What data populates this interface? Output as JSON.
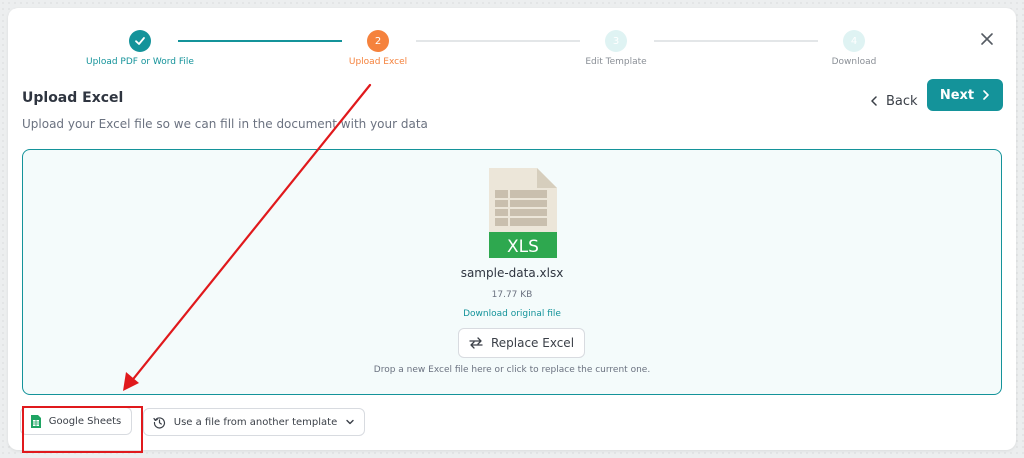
{
  "stepper": {
    "steps": [
      {
        "number": "",
        "label": "Upload PDF or Word File",
        "state": "completed",
        "icon": "check-icon"
      },
      {
        "number": "2",
        "label": "Upload Excel",
        "state": "active"
      },
      {
        "number": "3",
        "label": "Edit Template",
        "state": "pending"
      },
      {
        "number": "4",
        "label": "Download",
        "state": "pending"
      }
    ]
  },
  "header": {
    "title": "Upload Excel",
    "subtitle": "Upload your Excel file so we can fill in the document with your data",
    "back_label": "Back",
    "next_label": "Next"
  },
  "dropzone": {
    "file_icon_label": "XLS",
    "file_name": "sample-data.xlsx",
    "file_size": "17.77 KB",
    "download_link": "Download original file",
    "replace_label": "Replace Excel",
    "hint": "Drop a new Excel file here or click to replace the current one."
  },
  "actions": {
    "google_sheets_label": "Google Sheets",
    "template_file_label": "Use a file from another template"
  },
  "colors": {
    "primary": "#14939a",
    "active_step": "#f5823d",
    "annotation": "#e0191c",
    "excel_green": "#2ea84f"
  }
}
